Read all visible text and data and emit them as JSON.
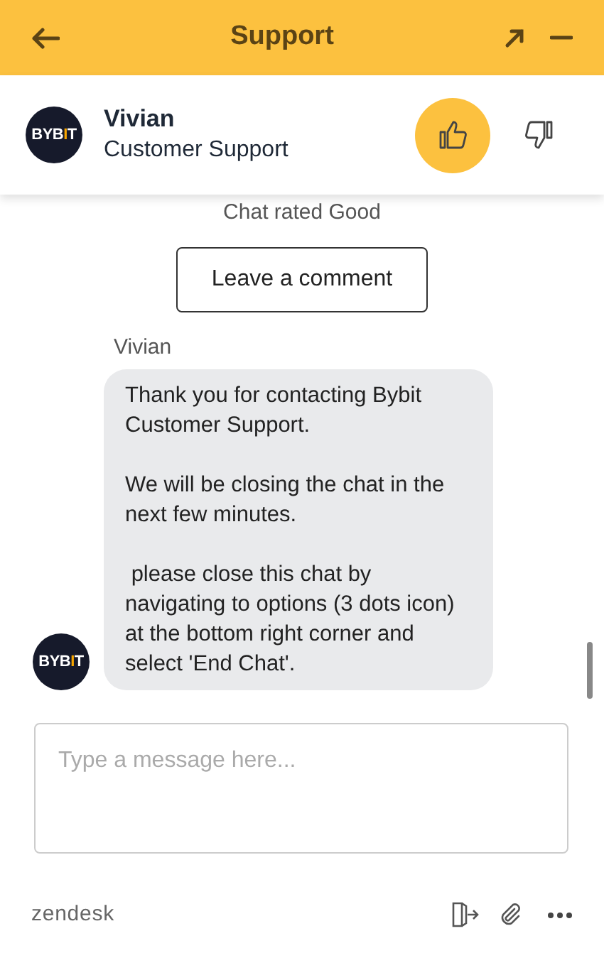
{
  "header": {
    "title": "Support"
  },
  "agent": {
    "name": "Vivian",
    "role": "Customer Support",
    "logo": [
      "BYB",
      "I",
      "T"
    ]
  },
  "rating": [
    {
      "kind": "up",
      "selected": true
    },
    {
      "kind": "down",
      "selected": false
    }
  ],
  "chat_status": "Chat rated Good",
  "comment_button": "Leave a comment",
  "message": {
    "sender": "Vivian",
    "logo": [
      "BYB",
      "I",
      "T"
    ],
    "paragraphs": [
      "Thank you for contacting Bybit Customer Support.",
      "We will be closing the chat in the next few minutes.",
      " please close this chat by navigating to options (3 dots icon) at the bottom right corner and select 'End Chat'."
    ]
  },
  "composer": {
    "placeholder": "Type a message here..."
  },
  "footer": {
    "brand": "zendesk"
  }
}
